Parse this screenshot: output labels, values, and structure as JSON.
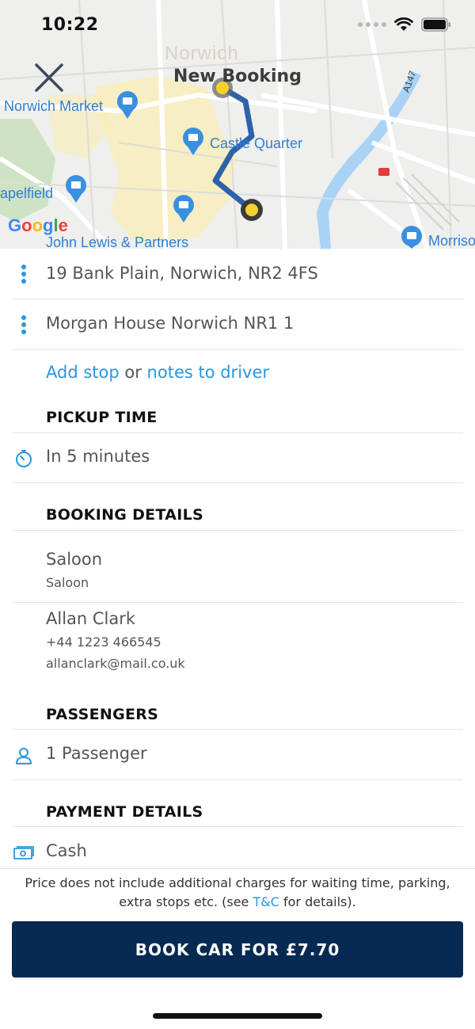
{
  "status_bar": {
    "time": "10:22"
  },
  "map": {
    "title": "New Booking",
    "labels": {
      "city": "Norwich",
      "norwich_market": "Norwich Market",
      "castle_quarter": "Castle Quarter",
      "chapelfield": "apelfield",
      "john_lewis": "John Lewis & Partners",
      "morrisons": "Morriso",
      "road": "A147"
    },
    "route_color": "#2e62a8",
    "pin_color": "#f5d22a",
    "google_logo": [
      "G",
      "o",
      "o",
      "g",
      "l",
      "e"
    ]
  },
  "route": {
    "pickup": "19 Bank Plain, Norwich, NR2 4FS",
    "dropoff": "Morgan House Norwich NR1 1",
    "add_stop": "Add stop",
    "or": "or",
    "notes_to_driver": "notes to driver"
  },
  "pickup_time": {
    "title": "PICKUP TIME",
    "value": "In 5 minutes"
  },
  "booking_details": {
    "title": "BOOKING DETAILS",
    "vehicle": "Saloon",
    "vehicle_sub": "Saloon",
    "name": "Allan Clark",
    "phone": "+44 1223 466545",
    "email": "allanclark@mail.co.uk"
  },
  "passengers": {
    "title": "PASSENGERS",
    "value": "1 Passenger"
  },
  "payment": {
    "title": "PAYMENT DETAILS",
    "value": "Cash"
  },
  "notice": {
    "line1": "Price does not include additional charges for waiting time, parking,",
    "line2_prefix": "extra stops etc. (see",
    "tc_link": "T&C",
    "line2_suffix": "for details)."
  },
  "book_button": {
    "label": "BOOK CAR FOR £7.70"
  },
  "colors": {
    "accent": "#2a96e0",
    "primary": "#062a52"
  }
}
